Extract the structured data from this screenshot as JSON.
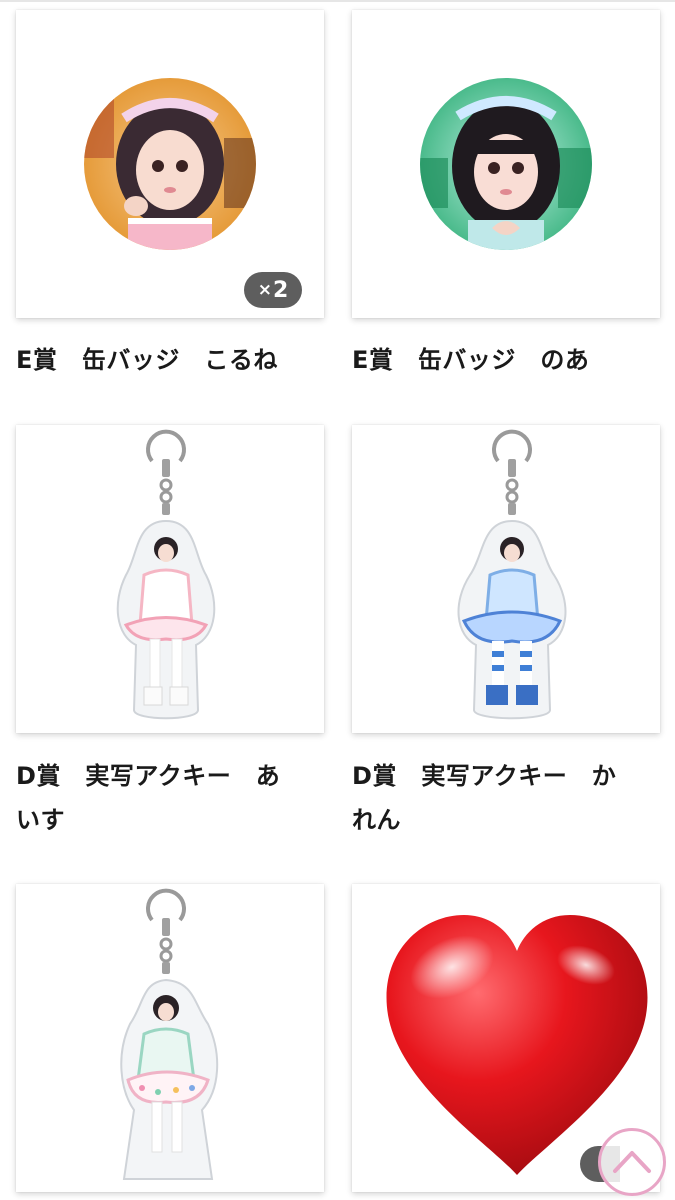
{
  "items": [
    {
      "title": "E賞　缶バッジ　こるね",
      "quantity_label": "×2",
      "quantity_mark": "×",
      "quantity_value": "2",
      "image": "can-badge-korune"
    },
    {
      "title": "E賞　缶バッジ　のあ",
      "image": "can-badge-noa"
    },
    {
      "title_line1": "D賞　実写アクキー　あ",
      "title_line2": "いす",
      "image": "acrylic-keychain-aisu"
    },
    {
      "title_line1": "D賞　実写アクキー　か",
      "title_line2": "れん",
      "image": "acrylic-keychain-karen"
    },
    {
      "image": "acrylic-keychain-third"
    },
    {
      "image": "heart-sticker-overlay"
    }
  ],
  "overlay": {
    "sticker": "red-heart-icon",
    "button": "scroll-to-top-icon"
  },
  "colors": {
    "badge_bg": "#5e5e5e",
    "scrolltop_ring": "#e8a5c6",
    "heart": "#e0141c"
  }
}
